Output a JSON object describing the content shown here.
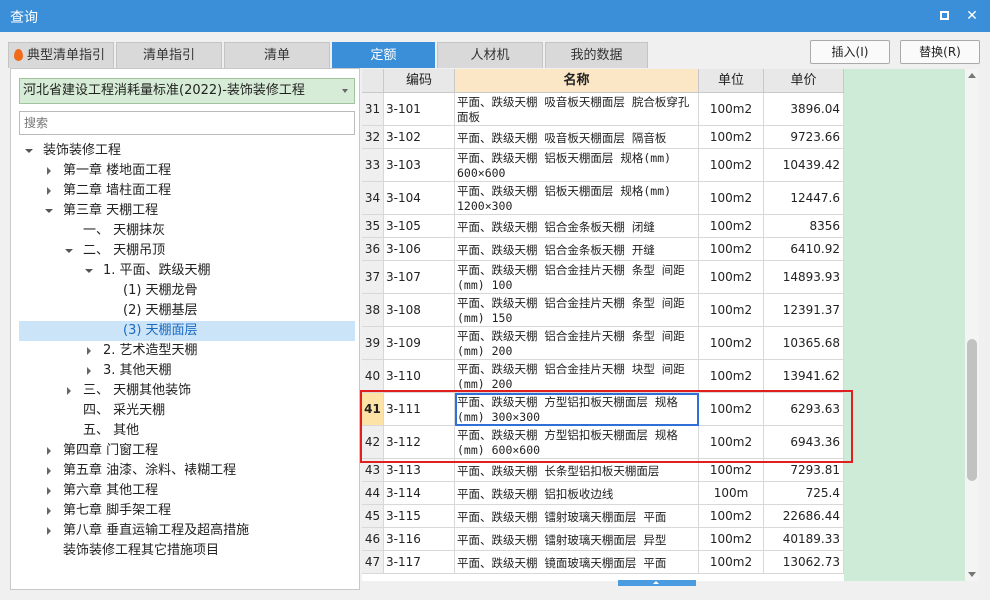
{
  "window": {
    "title": "查询"
  },
  "tabs": [
    {
      "label": "典型清单指引"
    },
    {
      "label": "清单指引"
    },
    {
      "label": "清单"
    },
    {
      "label": "定额"
    },
    {
      "label": "人材机"
    },
    {
      "label": "我的数据"
    }
  ],
  "buttons": {
    "insert": "插入(I)",
    "replace": "替换(R)"
  },
  "library": {
    "selected": "河北省建设工程消耗量标准(2022)-装饰装修工程"
  },
  "search": {
    "placeholder": "搜索"
  },
  "tree": [
    {
      "label": "装饰装修工程",
      "state": "expanded"
    },
    {
      "label": "第一章 楼地面工程",
      "state": "collapsed"
    },
    {
      "label": "第二章 墙柱面工程",
      "state": "collapsed"
    },
    {
      "label": "第三章 天棚工程",
      "state": "expanded"
    },
    {
      "label": "一、 天棚抹灰",
      "state": "leaf"
    },
    {
      "label": "二、 天棚吊顶",
      "state": "expanded"
    },
    {
      "label": "1. 平面、跌级天棚",
      "state": "expanded"
    },
    {
      "label": "(1) 天棚龙骨",
      "state": "leaf"
    },
    {
      "label": "(2) 天棚基层",
      "state": "leaf"
    },
    {
      "label": "(3) 天棚面层",
      "state": "leaf",
      "selected": true
    },
    {
      "label": "2. 艺术造型天棚",
      "state": "collapsed"
    },
    {
      "label": "3. 其他天棚",
      "state": "collapsed"
    },
    {
      "label": "三、 天棚其他装饰",
      "state": "collapsed"
    },
    {
      "label": "四、 采光天棚",
      "state": "leaf"
    },
    {
      "label": "五、 其他",
      "state": "leaf"
    },
    {
      "label": "第四章 门窗工程",
      "state": "collapsed"
    },
    {
      "label": "第五章 油漆、涂料、裱糊工程",
      "state": "collapsed"
    },
    {
      "label": "第六章 其他工程",
      "state": "collapsed"
    },
    {
      "label": "第七章 脚手架工程",
      "state": "collapsed"
    },
    {
      "label": "第八章 垂直运输工程及超高措施",
      "state": "collapsed"
    },
    {
      "label": "装饰装修工程其它措施项目",
      "state": "leaf"
    }
  ],
  "table": {
    "columns": {
      "code": "编码",
      "name": "名称",
      "unit": "单位",
      "price": "单价"
    },
    "rows": [
      {
        "idx": "31",
        "code": "3-101",
        "name": "平面、跌级天棚 吸音板天棚面层 脘合板穿孔面板",
        "unit": "100m2",
        "price": "3896.04"
      },
      {
        "idx": "32",
        "code": "3-102",
        "name": "平面、跌级天棚 吸音板天棚面层 隔音板",
        "unit": "100m2",
        "price": "9723.66"
      },
      {
        "idx": "33",
        "code": "3-103",
        "name": "平面、跌级天棚 铝板天棚面层 规格(mm) 600×600",
        "unit": "100m2",
        "price": "10439.42"
      },
      {
        "idx": "34",
        "code": "3-104",
        "name": "平面、跌级天棚 铝板天棚面层 规格(mm) 1200×300",
        "unit": "100m2",
        "price": "12447.6"
      },
      {
        "idx": "35",
        "code": "3-105",
        "name": "平面、跌级天棚 铝合金条板天棚 闭缝",
        "unit": "100m2",
        "price": "8356"
      },
      {
        "idx": "36",
        "code": "3-106",
        "name": "平面、跌级天棚 铝合金条板天棚 开缝",
        "unit": "100m2",
        "price": "6410.92"
      },
      {
        "idx": "37",
        "code": "3-107",
        "name": "平面、跌级天棚 铝合金挂片天棚 条型 间距(mm) 100",
        "unit": "100m2",
        "price": "14893.93"
      },
      {
        "idx": "38",
        "code": "3-108",
        "name": "平面、跌级天棚 铝合金挂片天棚 条型 间距(mm) 150",
        "unit": "100m2",
        "price": "12391.37"
      },
      {
        "idx": "39",
        "code": "3-109",
        "name": "平面、跌级天棚 铝合金挂片天棚 条型 间距(mm) 200",
        "unit": "100m2",
        "price": "10365.68"
      },
      {
        "idx": "40",
        "code": "3-110",
        "name": "平面、跌级天棚 铝合金挂片天棚 块型 间距(mm) 200",
        "unit": "100m2",
        "price": "13941.62"
      },
      {
        "idx": "41",
        "code": "3-111",
        "name": "平面、跌级天棚 方型铝扣板天棚面层 规格(mm) 300×300",
        "unit": "100m2",
        "price": "6293.63",
        "current": true
      },
      {
        "idx": "42",
        "code": "3-112",
        "name": "平面、跌级天棚 方型铝扣板天棚面层 规格(mm) 600×600",
        "unit": "100m2",
        "price": "6943.36"
      },
      {
        "idx": "43",
        "code": "3-113",
        "name": "平面、跌级天棚 长条型铝扣板天棚面层",
        "unit": "100m2",
        "price": "7293.81"
      },
      {
        "idx": "44",
        "code": "3-114",
        "name": "平面、跌级天棚 铝扣板收边线",
        "unit": "100m",
        "price": "725.4"
      },
      {
        "idx": "45",
        "code": "3-115",
        "name": "平面、跌级天棚 镭射玻璃天棚面层 平面",
        "unit": "100m2",
        "price": "22686.44"
      },
      {
        "idx": "46",
        "code": "3-116",
        "name": "平面、跌级天棚 镭射玻璃天棚面层 异型",
        "unit": "100m2",
        "price": "40189.33"
      },
      {
        "idx": "47",
        "code": "3-117",
        "name": "平面、跌级天棚 镜面玻璃天棚面层 平面",
        "unit": "100m2",
        "price": "13062.73"
      }
    ]
  },
  "colors": {
    "accent": "#3a8fd8",
    "highlight": "#e02020",
    "selection": "#cce4f7",
    "library_bg": "#d7ecd7"
  }
}
